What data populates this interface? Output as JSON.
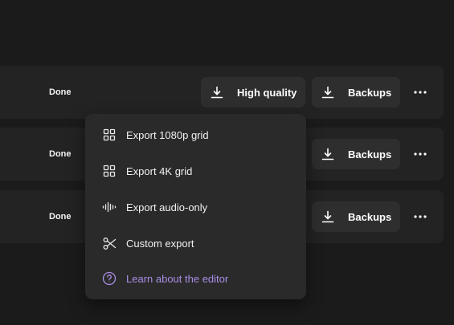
{
  "rows": [
    {
      "status": "Done",
      "high_quality_label": "High quality",
      "backups_label": "Backups"
    },
    {
      "status": "Done",
      "backups_label": "Backups"
    },
    {
      "status": "Done",
      "backups_label": "Backups"
    }
  ],
  "icons": {
    "download": "download-icon",
    "more": "more-horizontal-icon",
    "grid": "grid-icon",
    "audio": "audio-waveform-icon",
    "scissors": "scissors-icon",
    "help": "help-circle-icon"
  },
  "menu": {
    "items": [
      {
        "label": "Export 1080p grid",
        "icon": "grid-icon"
      },
      {
        "label": "Export 4K grid",
        "icon": "grid-icon"
      },
      {
        "label": "Export audio-only",
        "icon": "audio-waveform-icon"
      },
      {
        "label": "Custom export",
        "icon": "scissors-icon"
      }
    ],
    "learn_link": "Learn about the editor"
  },
  "colors": {
    "background": "#1b1b1b",
    "row": "#232323",
    "button": "#2e2e2e",
    "menu": "#2a2a2a",
    "link": "#a98ee6"
  }
}
